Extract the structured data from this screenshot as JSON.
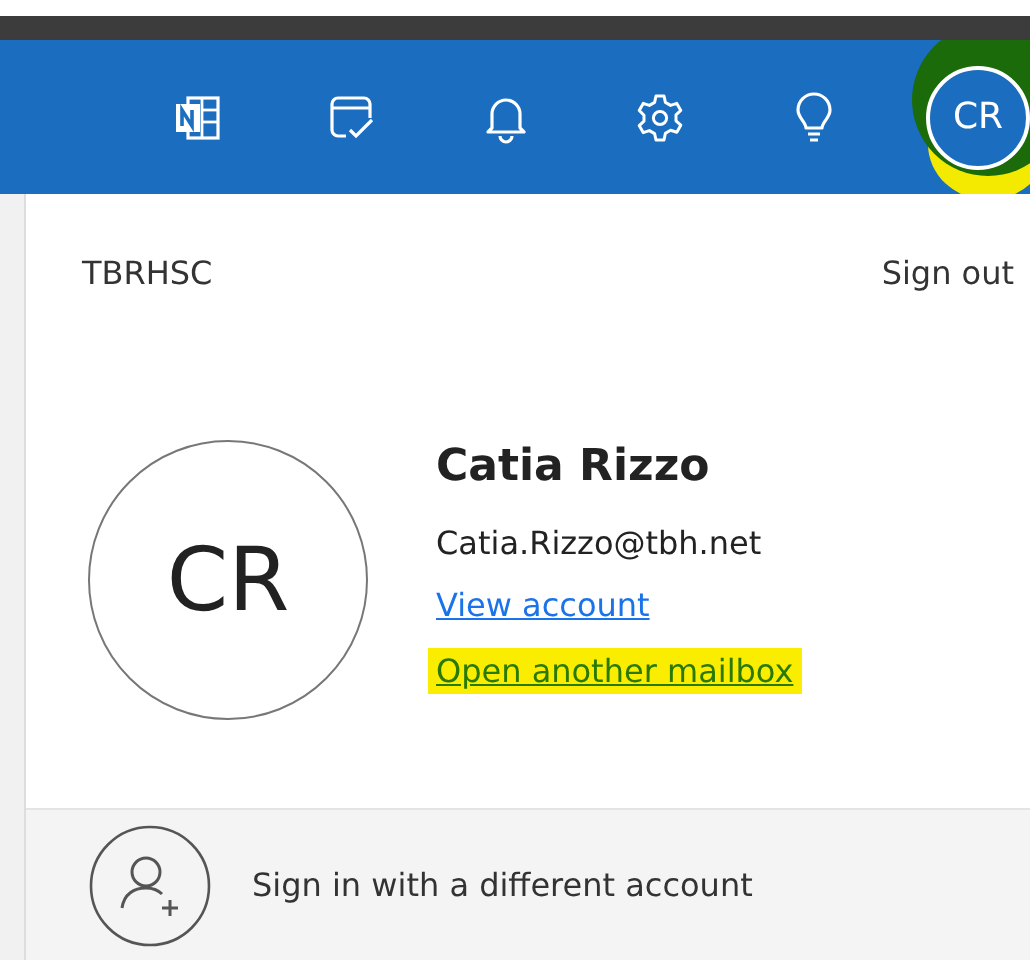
{
  "header": {
    "avatar": {
      "initials": "CR",
      "highlighted": true
    }
  },
  "account_panel": {
    "organization": "TBRHSC",
    "sign_out": "Sign out",
    "avatar_initials": "CR",
    "name": "Catia Rizzo",
    "email": "Catia.Rizzo@tbh.net",
    "links": [
      {
        "label": "View account",
        "highlighted": false
      },
      {
        "label": "Open another mailbox",
        "highlighted": true
      }
    ]
  },
  "other_account": {
    "label": "Sign in with a different account"
  }
}
